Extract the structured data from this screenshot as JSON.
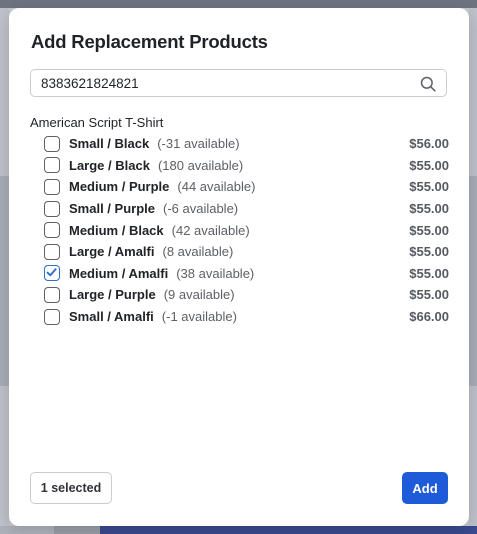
{
  "modal": {
    "title": "Add Replacement Products"
  },
  "search": {
    "value": "8383621824821",
    "icon": "search-icon"
  },
  "product": {
    "title": "American Script T-Shirt",
    "variants": [
      {
        "name": "Small / Black",
        "availability": "(-31 available)",
        "price": "$56.00",
        "checked": false
      },
      {
        "name": "Large / Black",
        "availability": "(180 available)",
        "price": "$55.00",
        "checked": false
      },
      {
        "name": "Medium / Purple",
        "availability": "(44 available)",
        "price": "$55.00",
        "checked": false
      },
      {
        "name": "Small / Purple",
        "availability": "(-6 available)",
        "price": "$55.00",
        "checked": false
      },
      {
        "name": "Medium / Black",
        "availability": "(42 available)",
        "price": "$55.00",
        "checked": false
      },
      {
        "name": "Large / Amalfi",
        "availability": "(8 available)",
        "price": "$55.00",
        "checked": false
      },
      {
        "name": "Medium / Amalfi",
        "availability": "(38 available)",
        "price": "$55.00",
        "checked": true
      },
      {
        "name": "Large / Purple",
        "availability": "(9 available)",
        "price": "$55.00",
        "checked": false
      },
      {
        "name": "Small / Amalfi",
        "availability": "(-1 available)",
        "price": "$66.00",
        "checked": false
      }
    ]
  },
  "footer": {
    "selected_label": "1 selected",
    "add_label": "Add"
  },
  "colors": {
    "accent": "#1e5bd8",
    "checkbox_checked": "#2c6ecb",
    "text_primary": "#1f2328",
    "text_secondary": "#5c6066"
  }
}
